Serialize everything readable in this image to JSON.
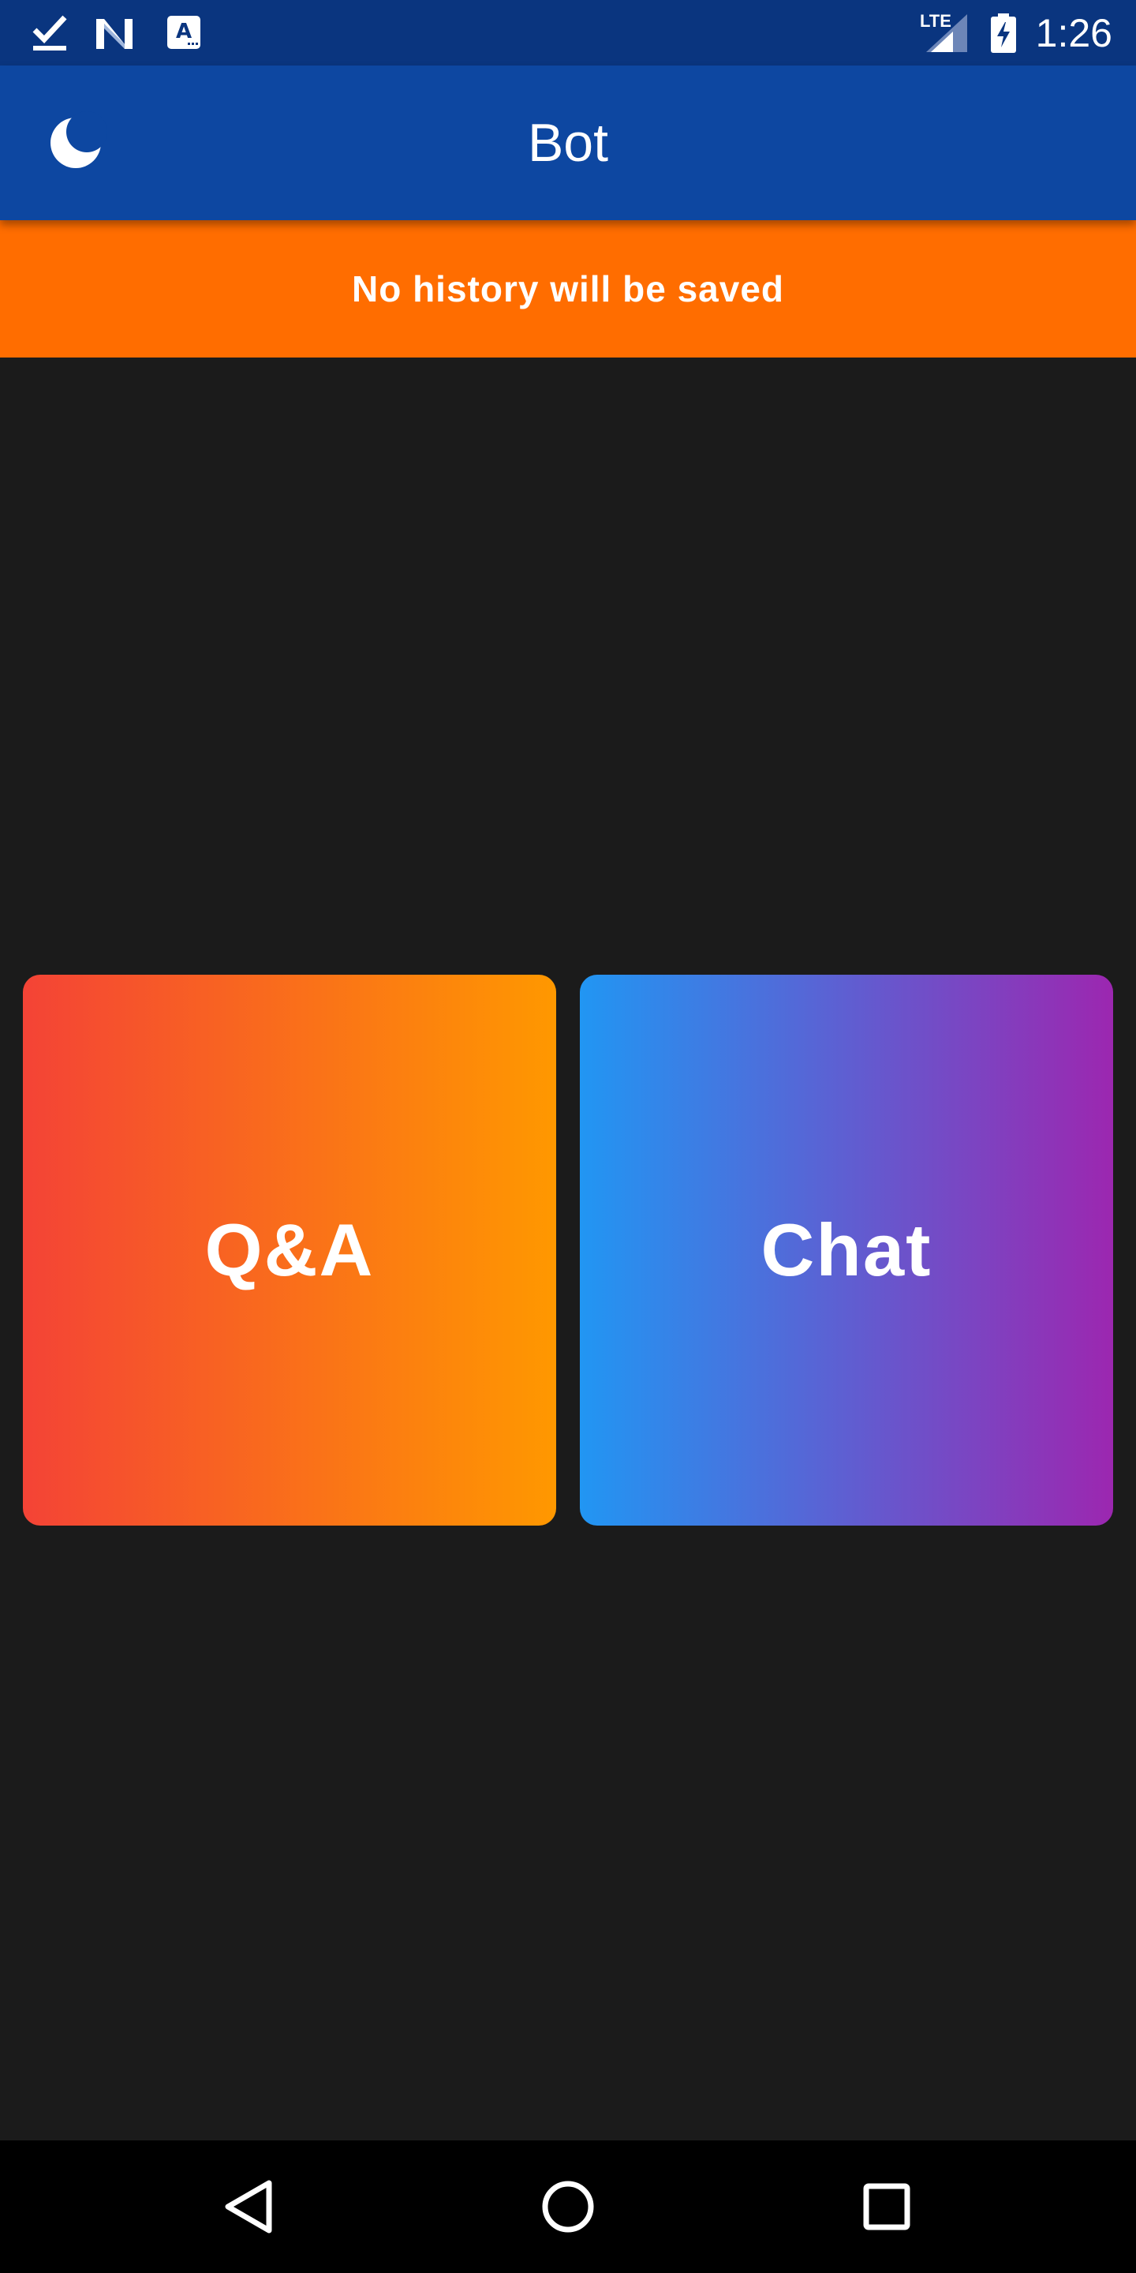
{
  "status_bar": {
    "time": "1:26",
    "network": "LTE",
    "icons": [
      "check-icon",
      "n-logo-icon",
      "a-keyboard-icon",
      "lte-signal-icon",
      "battery-charging-icon"
    ]
  },
  "app_bar": {
    "title": "Bot",
    "leading_icon": "moon-icon"
  },
  "banner": {
    "text": "No history will be saved",
    "color": "#ff6d00"
  },
  "cards": [
    {
      "label": "Q&A",
      "gradient": [
        "#f44336",
        "#ff9800"
      ]
    },
    {
      "label": "Chat",
      "gradient": [
        "#2196f3",
        "#9c27b0"
      ]
    }
  ],
  "nav_bar": {
    "buttons": [
      "back-icon",
      "home-icon",
      "recents-icon"
    ]
  },
  "colors": {
    "status_bar": "#0a357f",
    "app_bar": "#0d47a1",
    "background": "#1b1b1b"
  }
}
